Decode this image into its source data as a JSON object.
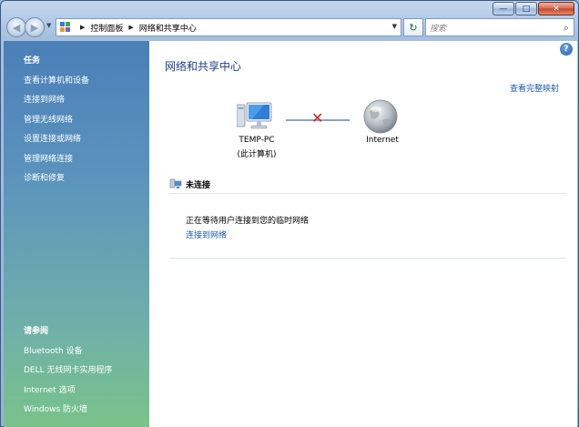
{
  "window": {
    "caption_buttons": {
      "minimize": "—",
      "maximize": "□",
      "close": "✕"
    }
  },
  "navbar": {
    "breadcrumb": [
      "控制面板",
      "网络和共享中心"
    ],
    "search_placeholder": "搜索"
  },
  "sidebar": {
    "tasks_heading": "任务",
    "tasks": [
      "查看计算机和设备",
      "连接到网络",
      "管理无线网络",
      "设置连接或网络",
      "管理网络连接",
      "诊断和修复"
    ],
    "see_also_heading": "请参阅",
    "see_also": [
      "Bluetooth 设备",
      "DELL 无线网卡实用程序",
      "Internet 选项",
      "Windows 防火墙"
    ]
  },
  "main": {
    "title": "网络和共享中心",
    "full_map_link": "查看完整映射",
    "computer_name": "TEMP-PC",
    "computer_sub": "(此计算机)",
    "internet_label": "Internet",
    "status": "未连接",
    "waiting_message": "正在等待用户连接到您的临时网络",
    "connect_link": "连接到网络"
  },
  "colors": {
    "link": "#1f5cae",
    "title": "#1e3f8c",
    "disconnect_x": "#d52418"
  }
}
